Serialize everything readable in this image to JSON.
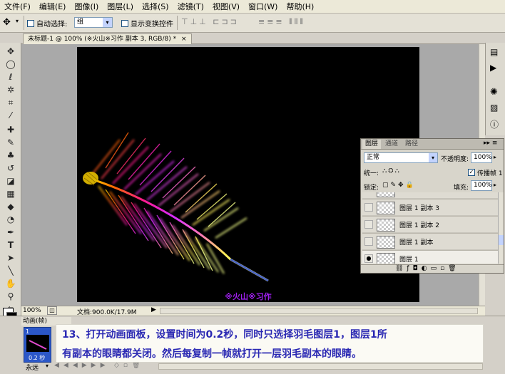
{
  "menu": [
    "文件(F)",
    "编辑(E)",
    "图像(I)",
    "图层(L)",
    "选择(S)",
    "滤镜(T)",
    "视图(V)",
    "窗口(W)",
    "帮助(H)"
  ],
  "options": {
    "auto_select_label": "自动选择:",
    "auto_select_value": "组",
    "show_transform_label": "显示变换控件"
  },
  "document": {
    "tab_title": "未标题-1 @ 100% (※火山※习作 副本 3, RGB/8) *",
    "watermark": "※火山※习作",
    "zoom": "100%",
    "doc_size": "文档:900.0K/17.9M"
  },
  "layers_panel": {
    "tabs": [
      "图层",
      "通道",
      "路径"
    ],
    "blend_mode": "正常",
    "opacity_label": "不透明度:",
    "opacity": "100%",
    "unify_label": "统一:",
    "propagate_label": "传播帧 1",
    "lock_label": "锁定:",
    "fill_label": "填充:",
    "fill": "100%",
    "layers": [
      {
        "name": "图层 1 副本 3",
        "visible": false
      },
      {
        "name": "图层 1 副本 2",
        "visible": false
      },
      {
        "name": "图层 1 副本",
        "visible": false
      },
      {
        "name": "图层 1",
        "visible": true
      }
    ]
  },
  "animation": {
    "title": "动画(帧)",
    "frame_number": "1",
    "frame_delay": "0.2 秒",
    "loop": "永远"
  },
  "caption": {
    "line1": "13、打开动画面板，设置时间为0.2秒，同时只选择羽毛图层1，图层1所",
    "line2": "有副本的眼睛都关闭。然后每复制一帧就打开一层羽毛副本的眼睛。"
  },
  "colors": {
    "caption_text": "#2a28b3",
    "watermark": "#a020f0"
  }
}
